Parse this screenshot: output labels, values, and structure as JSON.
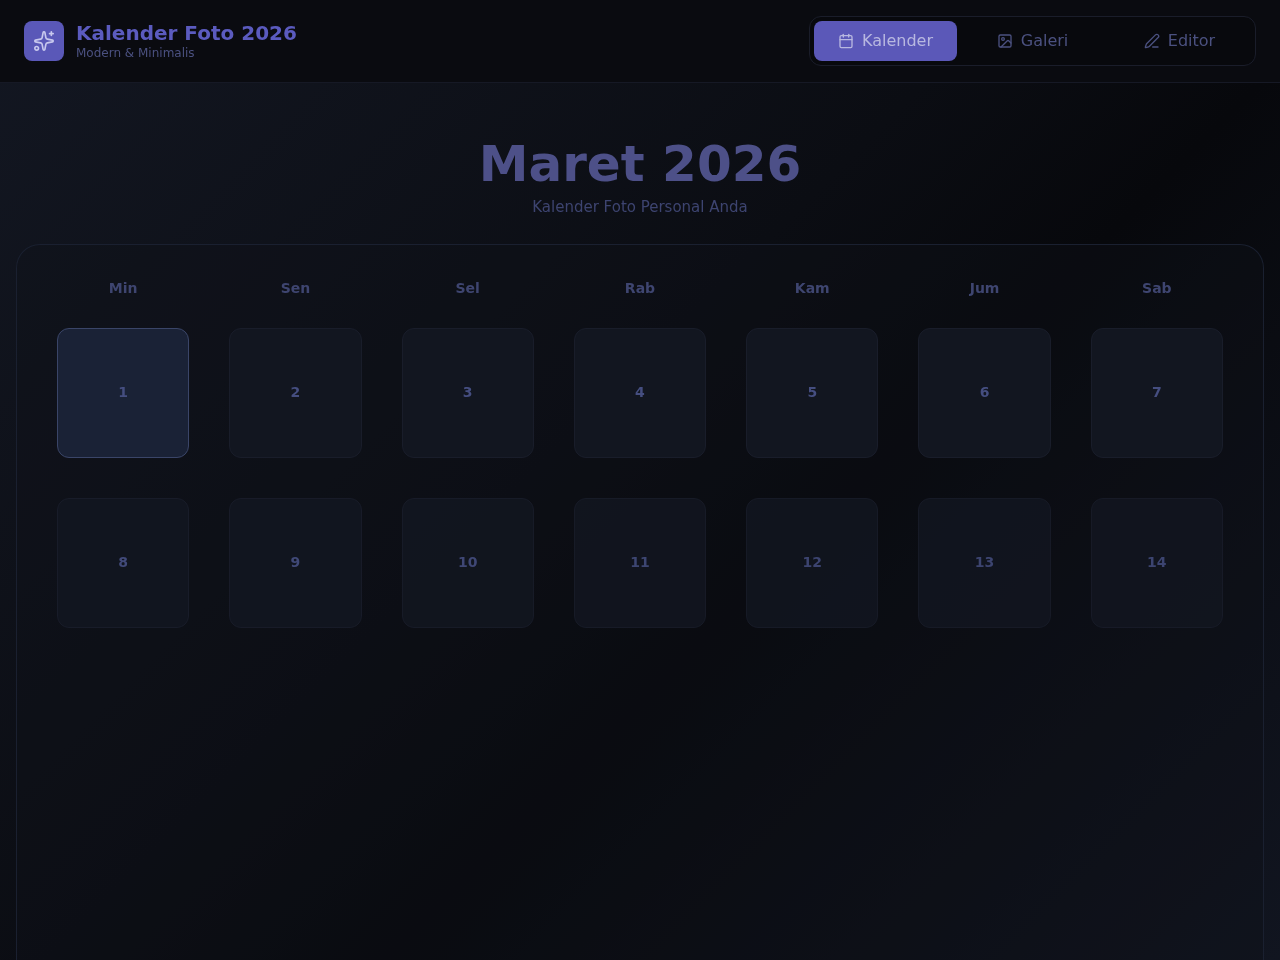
{
  "app": {
    "title": "Kalender Foto 2026",
    "subtitle": "Modern & Minimalis"
  },
  "nav": [
    {
      "label": "Kalender",
      "selected": true
    },
    {
      "label": "Galeri",
      "selected": false
    },
    {
      "label": "Editor",
      "selected": false
    }
  ],
  "month": {
    "title": "Maret 2026",
    "subtitle": "Kalender Foto Personal Anda"
  },
  "weekdays": [
    "Min",
    "Sen",
    "Sel",
    "Rab",
    "Kam",
    "Jum",
    "Sab"
  ],
  "days": [
    {
      "label": "1",
      "selected": true
    },
    {
      "label": "2",
      "selected": false
    },
    {
      "label": "3",
      "selected": false
    },
    {
      "label": "4",
      "selected": false
    },
    {
      "label": "5",
      "selected": false
    },
    {
      "label": "6",
      "selected": false
    },
    {
      "label": "7",
      "selected": false
    },
    {
      "label": "8",
      "selected": false
    },
    {
      "label": "9",
      "selected": false
    },
    {
      "label": "10",
      "selected": false
    },
    {
      "label": "11",
      "selected": false
    },
    {
      "label": "12",
      "selected": false
    },
    {
      "label": "13",
      "selected": false
    },
    {
      "label": "14",
      "selected": false
    }
  ]
}
